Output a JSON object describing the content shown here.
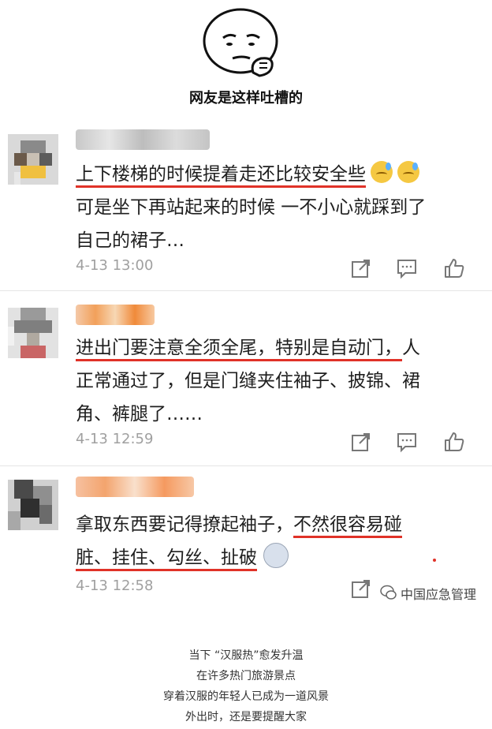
{
  "header": {
    "title": "网友是这样吐槽的"
  },
  "comments": [
    {
      "lines": [
        {
          "underlined": "上下楼梯的时候提着走还比较安全些",
          "rest": ""
        },
        {
          "underlined": "",
          "rest": "可是坐下再站起来的时候 一不小心就踩到了"
        },
        {
          "underlined": "",
          "rest": "自己的裙子…"
        }
      ],
      "time": "4-13 13:00"
    },
    {
      "lines": [
        {
          "underlined": "进出门要注意全须全尾，特别是自动门，",
          "rest": "人"
        },
        {
          "underlined": "",
          "rest": "正常通过了，但是门缝夹住袖子、披锦、裙"
        },
        {
          "underlined": "",
          "rest": "角、裤腿了……"
        }
      ],
      "time": "4-13 12:59"
    },
    {
      "lines": [
        {
          "prefix": "拿取东西要记得撩起袖子，",
          "underlined": "不然很容易碰"
        },
        {
          "underlined": "脏、挂住、勾丝、扯破",
          "rest": ""
        }
      ],
      "time": "4-13 12:58"
    }
  ],
  "watermark": {
    "text": "中国应急管理"
  },
  "caption": {
    "lines": [
      "当下 “汉服热”愈发升温",
      "在许多热门旅游景点",
      "穿着汉服的年轻人已成为一道风景",
      "外出时，还是要提醒大家"
    ]
  },
  "icons": [
    "share-icon",
    "comment-icon",
    "like-icon"
  ],
  "colors": {
    "underline": "#e03228",
    "time": "#a0a0a0"
  }
}
